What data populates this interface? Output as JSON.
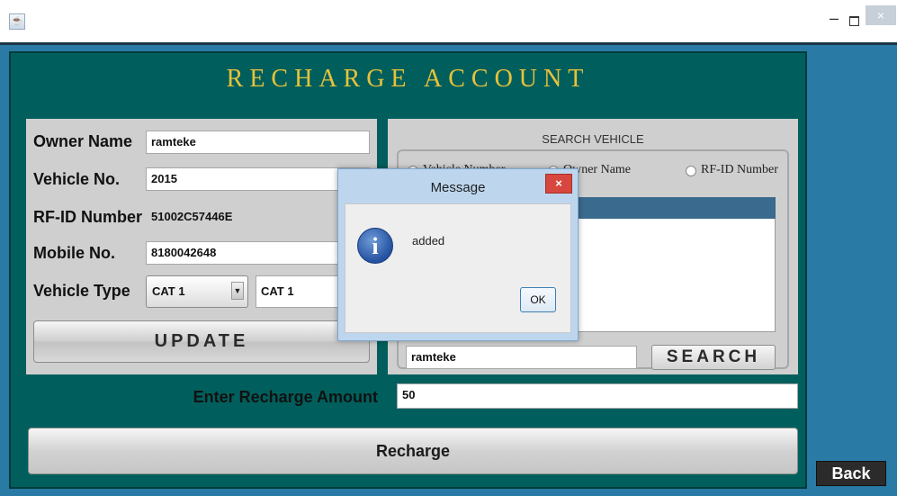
{
  "window": {
    "title": "",
    "app_icon_glyph": "☕",
    "minimize_glyph": "–",
    "close_glyph": "×"
  },
  "page_title": "RECHARGE ACCOUNT",
  "form": {
    "owner_name": {
      "label": "Owner Name",
      "value": "ramteke"
    },
    "vehicle_no": {
      "label": "Vehicle No.",
      "value": "2015"
    },
    "rfid": {
      "label": "RF-ID Number",
      "value": "51002C57446E"
    },
    "mobile": {
      "label": "Mobile No.",
      "value": "8180042648"
    },
    "vehicle_type": {
      "label": "Vehicle Type",
      "selected": "CAT 1",
      "value": "CAT 1"
    },
    "update_label": "UPDATE"
  },
  "search": {
    "title": "SEARCH VEHICLE",
    "options": [
      {
        "label": "Vehicle Number",
        "selected": false
      },
      {
        "label": "Owner Name",
        "selected": true
      },
      {
        "label": "RF-ID Number",
        "selected": false
      }
    ],
    "query": "ramteke",
    "button_label": "SEARCH"
  },
  "recharge": {
    "amount_label": "Enter Recharge Amount",
    "amount_value": "50",
    "button_label": "Recharge"
  },
  "back_label": "Back",
  "dialog": {
    "title": "Message",
    "message": "added",
    "ok_label": "OK",
    "icon": "info-icon"
  },
  "colors": {
    "frame": "#2a7aa6",
    "main_panel": "#005f5c",
    "title_gold": "#e8c23a",
    "dialog_frame": "#bdd6ee",
    "dialog_close": "#d7473f"
  }
}
